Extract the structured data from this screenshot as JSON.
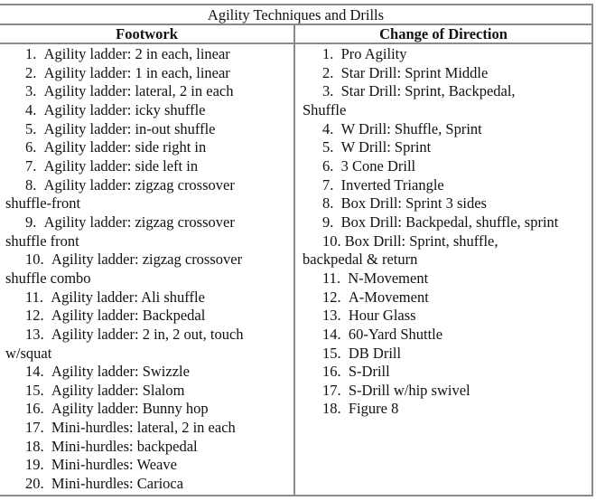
{
  "table": {
    "title": "Agility Techniques and Drills",
    "columns": [
      {
        "header": "Footwork",
        "items": [
          {
            "num": "1.",
            "text": "Agility ladder: 2 in each, linear"
          },
          {
            "num": "2.",
            "text": "Agility ladder: 1 in each, linear"
          },
          {
            "num": "3.",
            "text": "Agility ladder: lateral, 2 in each"
          },
          {
            "num": "4.",
            "text": "Agility ladder: icky shuffle"
          },
          {
            "num": "5.",
            "text": "Agility ladder: in-out shuffle"
          },
          {
            "num": "6.",
            "text": "Agility ladder: side right in"
          },
          {
            "num": "7.",
            "text": "Agility ladder: side left in"
          },
          {
            "num": "8.",
            "text": "Agility ladder: zigzag crossover",
            "cont": "shuffle-front"
          },
          {
            "num": "9.",
            "text": "Agility ladder: zigzag crossover",
            "cont": "shuffle front"
          },
          {
            "num": "10.",
            "text": "Agility ladder: zigzag crossover",
            "cont": "shuffle combo"
          },
          {
            "num": "11.",
            "text": "Agility ladder: Ali shuffle"
          },
          {
            "num": "12.",
            "text": "Agility ladder: Backpedal"
          },
          {
            "num": "13.",
            "text": "Agility ladder: 2 in, 2 out, touch",
            "cont": "w/squat"
          },
          {
            "num": "14.",
            "text": "Agility ladder: Swizzle"
          },
          {
            "num": "15.",
            "text": "Agility ladder: Slalom"
          },
          {
            "num": "16.",
            "text": "Agility ladder: Bunny hop"
          },
          {
            "num": "17.",
            "text": "Mini-hurdles: lateral, 2 in each"
          },
          {
            "num": "18.",
            "text": "Mini-hurdles: backpedal"
          },
          {
            "num": "19.",
            "text": "Mini-hurdles: Weave"
          },
          {
            "num": "20.",
            "text": "Mini-hurdles: Carioca"
          }
        ]
      },
      {
        "header": "Change of Direction",
        "items": [
          {
            "num": "1.",
            "text": "Pro Agility"
          },
          {
            "num": "2.",
            "text": "Star Drill: Sprint Middle"
          },
          {
            "num": "3.",
            "text": "Star Drill: Sprint, Backpedal,",
            "cont": "Shuffle"
          },
          {
            "num": "4.",
            "text": "W Drill: Shuffle, Sprint"
          },
          {
            "num": "5.",
            "text": "W Drill: Sprint"
          },
          {
            "num": "6.",
            "text": "3 Cone Drill"
          },
          {
            "num": "7.",
            "text": "Inverted Triangle"
          },
          {
            "num": "8.",
            "text": "Box Drill: Sprint 3 sides"
          },
          {
            "num": "9.",
            "text": "Box Drill: Backpedal, shuffle, sprint"
          },
          {
            "num": "10.",
            "text": "Box Drill: Sprint, shuffle,",
            "cont": "backpedal & return"
          },
          {
            "num": "11.",
            "text": "N-Movement"
          },
          {
            "num": "12.",
            "text": "A-Movement"
          },
          {
            "num": "13.",
            "text": "Hour Glass"
          },
          {
            "num": "14.",
            "text": "60-Yard Shuttle"
          },
          {
            "num": "15.",
            "text": "DB Drill"
          },
          {
            "num": "16.",
            "text": "S-Drill"
          },
          {
            "num": "17.",
            "text": "S-Drill w/hip swivel"
          },
          {
            "num": "18.",
            "text": "Figure 8"
          }
        ]
      }
    ]
  }
}
